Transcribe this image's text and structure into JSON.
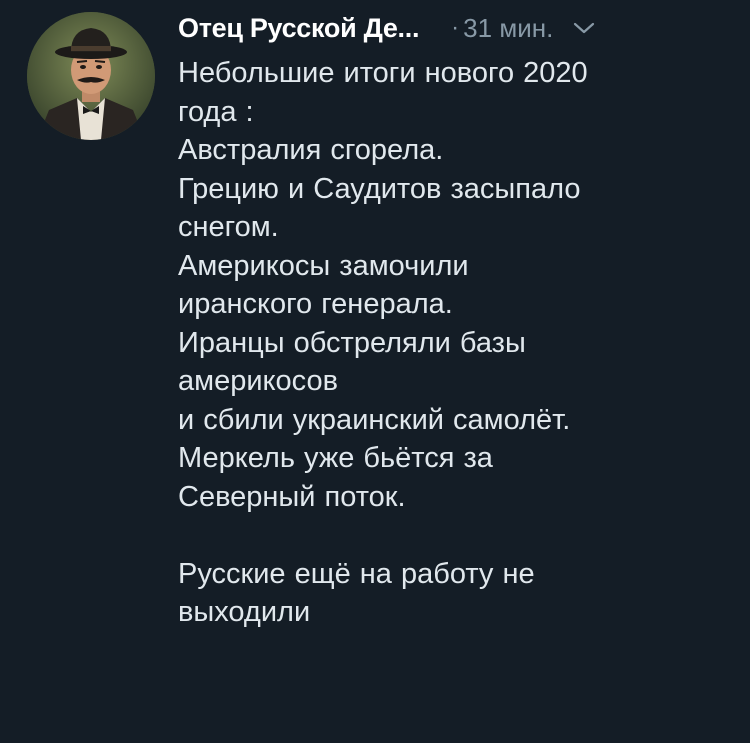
{
  "tweet": {
    "author_name": "Отец Русской Де...",
    "separator": "·",
    "timestamp": "31 мин.",
    "body": "Небольшие итоги нового 2020\nгода :\nАвстралия сгорела.\nГрецию и Саудитов засыпало\nснегом.\nАмерикосы замочили\nиранского генерала.\nИранцы обстреляли базы\nамерикосов\nи сбили украинский самолёт.\nМеркель уже бьётся за\nСеверный поток.\n\nРусские ещё на работу не\nвыходили"
  },
  "icons": {
    "menu": "chevron-down-icon",
    "avatar": "avatar"
  },
  "colors": {
    "background": "#141d26",
    "text": "#e1e8ed",
    "muted": "#8899a6"
  }
}
